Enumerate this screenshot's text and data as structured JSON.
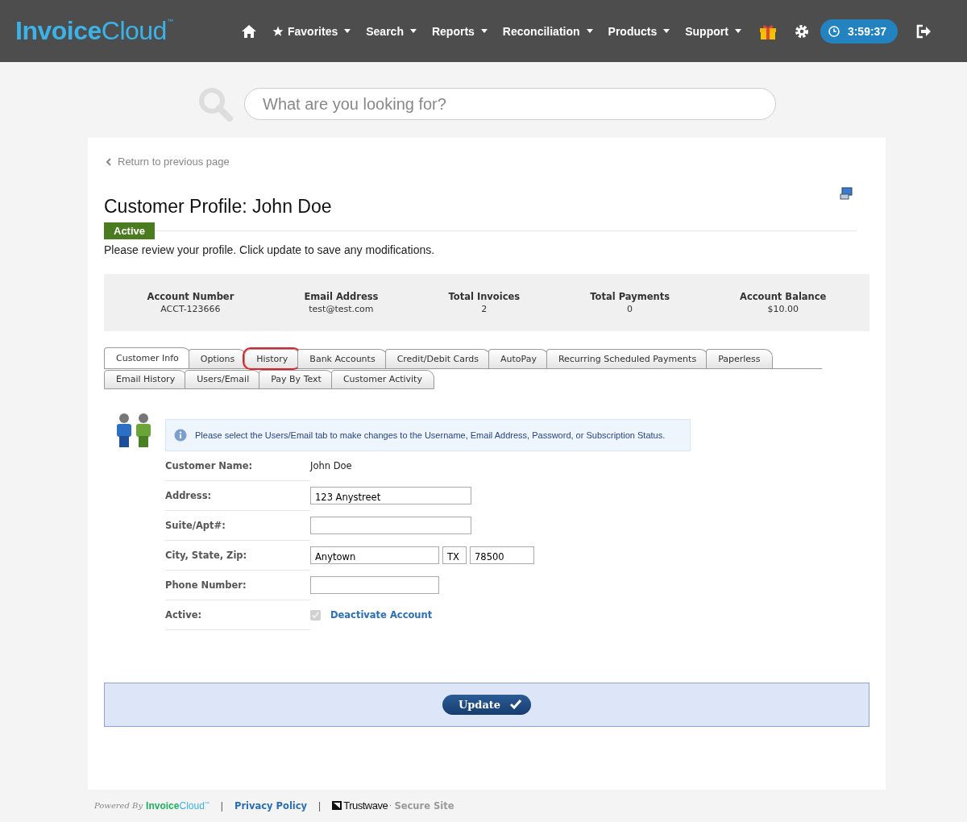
{
  "logo": {
    "bold": "Invoice",
    "light": "Cloud",
    "mark": "™"
  },
  "nav": [
    {
      "kind": "home"
    },
    {
      "kind": "menu",
      "label": "Favorites",
      "star": true
    },
    {
      "kind": "menu",
      "label": "Search",
      "star": false
    },
    {
      "kind": "menu",
      "label": "Reports",
      "star": false
    },
    {
      "kind": "menu",
      "label": "Reconciliation",
      "star": false
    },
    {
      "kind": "menu",
      "label": "Products",
      "star": false
    },
    {
      "kind": "menu",
      "label": "Support",
      "star": false
    },
    {
      "kind": "gift"
    },
    {
      "kind": "gear"
    },
    {
      "kind": "timer",
      "label": "3:59:37"
    },
    {
      "kind": "logout"
    }
  ],
  "search": {
    "placeholder": "What are you looking for?"
  },
  "back_link": "Return to previous page",
  "title": "Customer Profile: John Doe",
  "status_badge": "Active",
  "intro": "Please review your profile. Click update to save any modifications.",
  "summary": [
    {
      "label": "Account Number",
      "value": "ACCT-123666"
    },
    {
      "label": "Email Address",
      "value": "test@test.com"
    },
    {
      "label": "Total Invoices",
      "value": "2"
    },
    {
      "label": "Total Payments",
      "value": "0"
    },
    {
      "label": "Account Balance",
      "value": "$10.00"
    }
  ],
  "tab_rows": [
    [
      {
        "label": "Customer Info",
        "selected": true,
        "circled": false
      },
      {
        "label": "Options",
        "selected": false,
        "circled": false
      },
      {
        "label": "History",
        "selected": false,
        "circled": true
      },
      {
        "label": "Bank Accounts",
        "selected": false,
        "circled": false
      },
      {
        "label": "Credit/Debit Cards",
        "selected": false,
        "circled": false
      },
      {
        "label": "AutoPay",
        "selected": false,
        "circled": false
      },
      {
        "label": "Recurring Scheduled Payments",
        "selected": false,
        "circled": false
      },
      {
        "label": "Paperless",
        "selected": false,
        "circled": false
      }
    ],
    [
      {
        "label": "Email History",
        "selected": false,
        "circled": false
      },
      {
        "label": "Users/Email",
        "selected": false,
        "circled": false
      },
      {
        "label": "Pay By Text",
        "selected": false,
        "circled": false
      },
      {
        "label": "Customer Activity",
        "selected": false,
        "circled": false
      }
    ]
  ],
  "info_note": "Please select the Users/Email tab to make changes to the Username, Email Address, Password, or Subscription Status.",
  "fields": [
    {
      "kind": "text",
      "label": "Customer Name:",
      "value": "John Doe"
    },
    {
      "kind": "inputs",
      "label": "Address:",
      "inputs": [
        {
          "value": "123 Anystreet"
        }
      ]
    },
    {
      "kind": "blank",
      "label": "Suite/Apt#:"
    },
    {
      "kind": "inputs",
      "label": "City, State, Zip:",
      "inputs": [
        {
          "value": "Anytown"
        },
        {
          "value": "TX"
        },
        {
          "value": "78500"
        }
      ]
    },
    {
      "kind": "blank",
      "label": "Phone Number:"
    },
    {
      "kind": "check",
      "label": "Active:",
      "checked": true,
      "disabled": true,
      "link": "Deactivate Account"
    }
  ],
  "update_button": "Update",
  "footer": {
    "powered_by": "Powered By",
    "logo": {
      "bold": "Invoice",
      "light": "Cloud",
      "mark": "™"
    },
    "separator_1": "|",
    "privacy": "Privacy Policy",
    "separator_2": "|",
    "trust_brand": "Trustwave",
    "trust_mark": "·",
    "secure": "Secure Site"
  }
}
